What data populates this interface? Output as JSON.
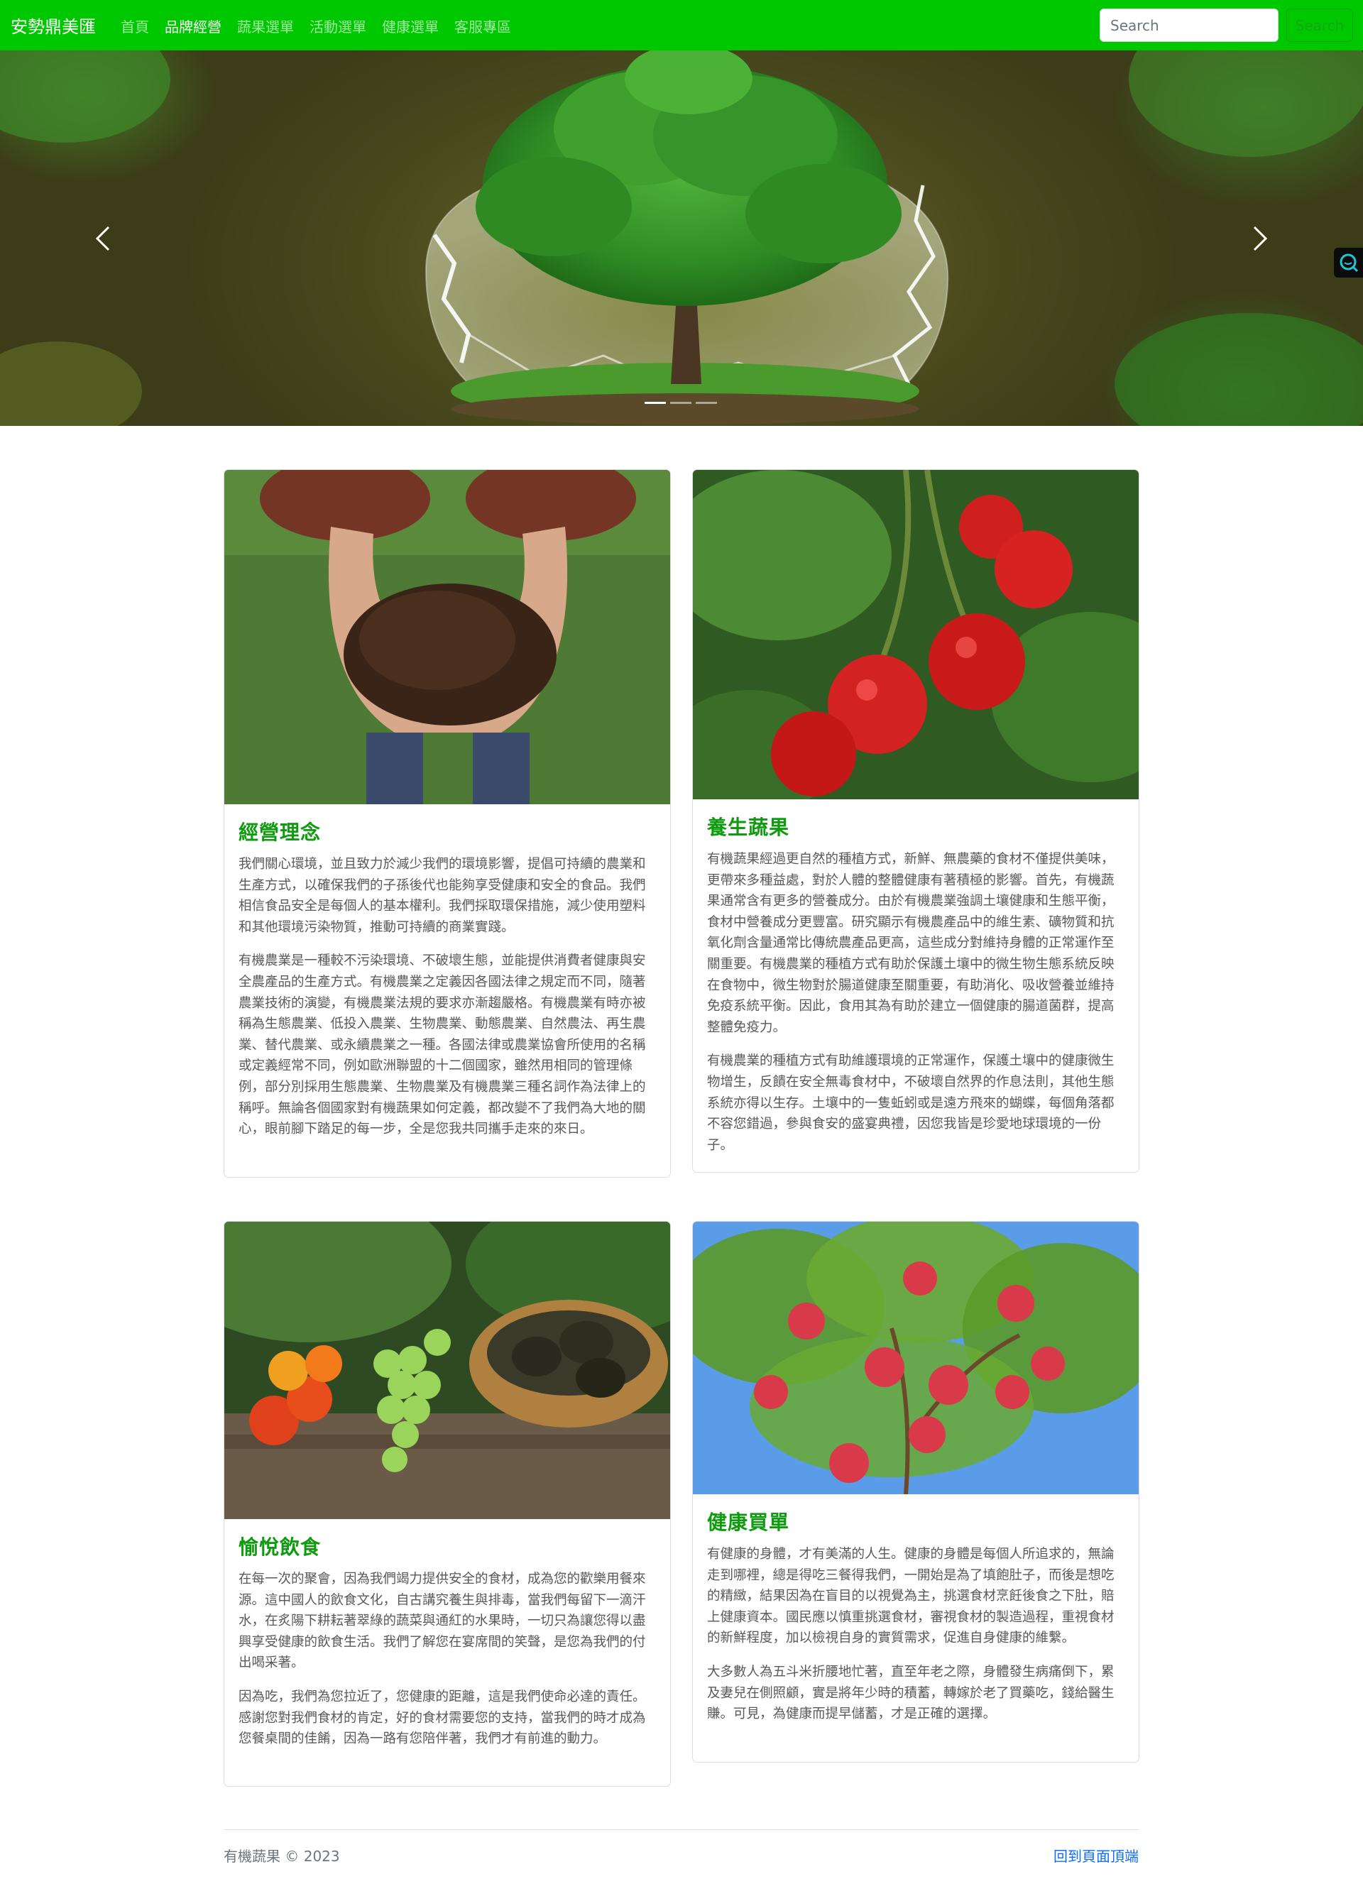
{
  "navbar": {
    "brand": "安勢鼎美匯",
    "links": [
      "首頁",
      "品牌經營",
      "蔬果選單",
      "活動選單",
      "健康選單",
      "客服專區"
    ],
    "active_index": 1,
    "search_placeholder": "Search",
    "search_button": "Search"
  },
  "carousel": {
    "slide_count": 3,
    "active_slide": 1
  },
  "cards": [
    {
      "title": "經營理念",
      "paragraphs": [
        "我們關心環境，並且致力於減少我們的環境影響，提倡可持續的農業和生產方式，以確保我們的子孫後代也能夠享受健康和安全的食品。我們相信食品安全是每個人的基本權利。我們採取環保措施，減少使用塑料和其他環境污染物質，推動可持續的商業實踐。",
        "有機農業是一種較不污染環境、不破壞生態，並能提供消費者健康與安全農產品的生產方式。有機農業之定義因各國法律之規定而不同，隨著農業技術的演變，有機農業法規的要求亦漸趨嚴格。有機農業有時亦被稱為生態農業、低投入農業、生物農業、動態農業、自然農法、再生農業、替代農業、或永續農業之一種。各國法律或農業協會所使用的名稱或定義經常不同，例如歐洲聯盟的十二個國家，雖然用相同的管理條例，部分別採用生態農業、生物農業及有機農業三種名詞作為法律上的稱呼。無論各個國家對有機蔬果如何定義，都改變不了我們為大地的關心，眼前腳下踏足的每一步，全是您我共同攜手走來的來日。"
      ]
    },
    {
      "title": "養生蔬果",
      "paragraphs": [
        "有機蔬果經過更自然的種植方式，新鮮、無農藥的食材不僅提供美味，更帶來多種益處，對於人體的整體健康有著積極的影響。首先，有機蔬果通常含有更多的營養成分。由於有機農業強調土壤健康和生態平衡，食材中營養成分更豐富。研究顯示有機農產品中的維生素、礦物質和抗氧化劑含量通常比傳統農產品更高，這些成分對維持身體的正常運作至關重要。有機農業的種植方式有助於保護土壤中的微生物生態系統反映在食物中，微生物對於腸道健康至關重要，有助消化、吸收營養並維持免疫系統平衡。因此，食用其為有助於建立一個健康的腸道菌群，提高整體免疫力。",
        "有機農業的種植方式有助維護環境的正常運作，保護土壤中的健康微生物增生，反饋在安全無毒食材中，不破壞自然界的作息法則，其他生態系統亦得以生存。土壤中的一隻蚯蚓或是遠方飛來的蝴蝶，每個角落都不容您錯過，參與食安的盛宴典禮，因您我皆是珍愛地球環境的一份子。"
      ]
    },
    {
      "title": "愉悅飲食",
      "paragraphs": [
        "在每一次的聚會，因為我們竭力提供安全的食材，成為您的歡樂用餐來源。這中國人的飲食文化，自古講究養生與排毒，當我們每留下一滴汗水，在炙陽下耕耘著翠綠的蔬菜與通紅的水果時，一切只為讓您得以盡興享受健康的飲食生活。我們了解您在宴席間的笑聲，是您為我們的付出喝采著。",
        "因為吃，我們為您拉近了，您健康的距離，這是我們使命必達的責任。感謝您對我們食材的肯定，好的食材需要您的支持，當我們的時才成為您餐桌間的佳餚，因為一路有您陪伴著，我們才有前進的動力。"
      ]
    },
    {
      "title": "健康買單",
      "paragraphs": [
        "有健康的身體，才有美滿的人生。健康的身體是每個人所追求的，無論走到哪裡，總是得吃三餐得我們，一開始是為了填飽肚子，而後是想吃的精緻，結果因為在盲目的以視覺為主，挑選食材烹飪後食之下肚，賠上健康資本。國民應以慎重挑選食材，審視食材的製造過程，重視食材的新鮮程度，加以檢視自身的實質需求，促進自身健康的維繫。",
        "大多數人為五斗米折腰地忙著，直至年老之際，身體發生病痛倒下，累及妻兒在側照顧，實是將年少時的積蓄，轉嫁於老了買藥吃，錢給醫生賺。可見，為健康而提早儲蓄，才是正確的選擇。"
      ]
    }
  ],
  "footer": {
    "copyright": "有機蔬果 © 2023",
    "back_to_top": "回到頁面頂端"
  },
  "colors": {
    "navbar": "#00c800",
    "card_title": "#0e9b0e",
    "link": "#0d6efd"
  }
}
